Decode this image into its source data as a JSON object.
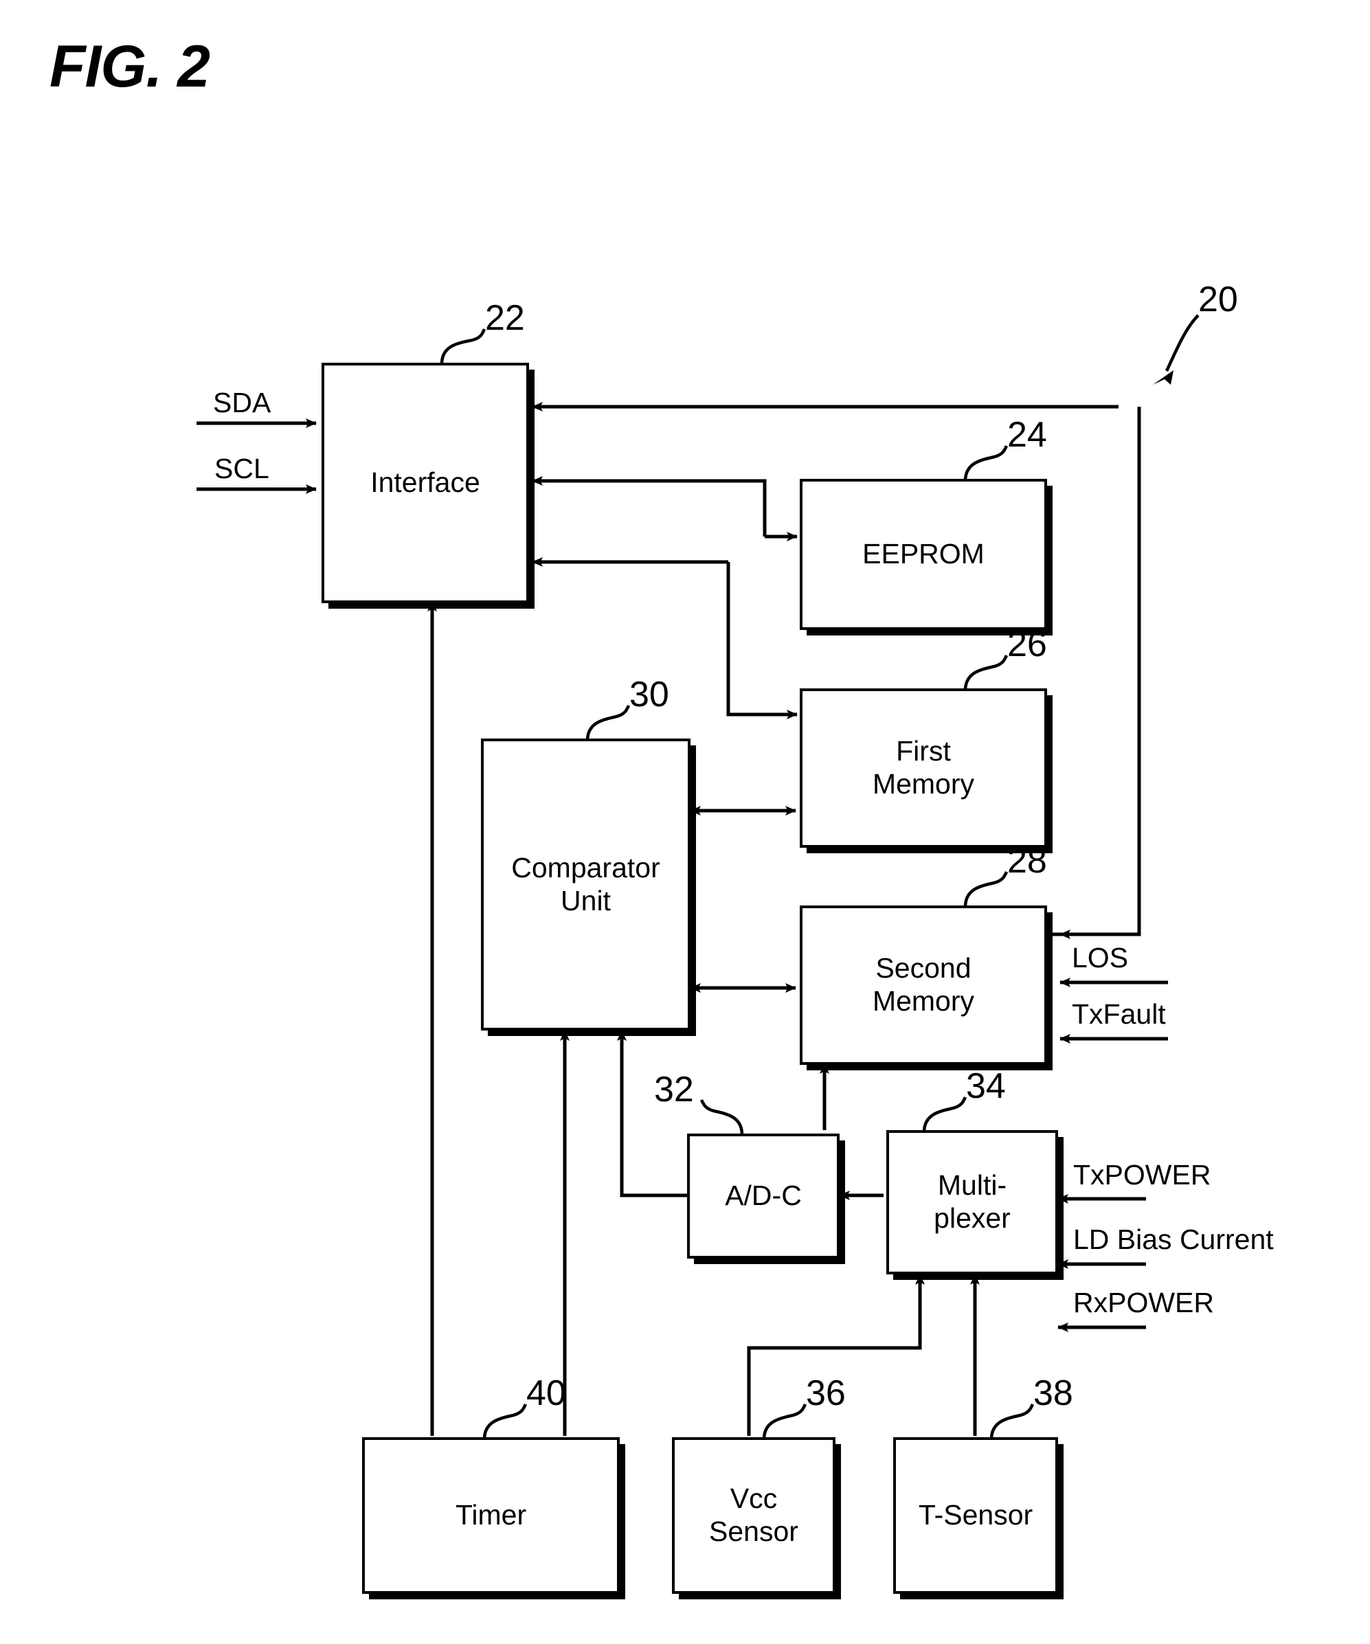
{
  "figure": {
    "title": "FIG. 2",
    "system_ref": "20"
  },
  "blocks": [
    {
      "id": "interface",
      "label": "Interface",
      "ref": "22"
    },
    {
      "id": "eeprom",
      "label": "EEPROM",
      "ref": "24"
    },
    {
      "id": "first_mem",
      "label": "First\nMemory",
      "ref": "26"
    },
    {
      "id": "second_mem",
      "label": "Second\nMemory",
      "ref": "28"
    },
    {
      "id": "comparator",
      "label": "Comparator\nUnit",
      "ref": "30"
    },
    {
      "id": "adc",
      "label": "A/D-C",
      "ref": "32"
    },
    {
      "id": "multiplexer",
      "label": "Multi-\nplexer",
      "ref": "34"
    },
    {
      "id": "vcc_sensor",
      "label": "Vcc\nSensor",
      "ref": "36"
    },
    {
      "id": "t_sensor",
      "label": "T-Sensor",
      "ref": "38"
    },
    {
      "id": "timer",
      "label": "Timer",
      "ref": "40"
    }
  ],
  "signals": {
    "interface_inputs": [
      "SDA",
      "SCL"
    ],
    "second_memory_inputs": [
      "LOS",
      "TxFault"
    ],
    "multiplexer_inputs": [
      "TxPOWER",
      "LD Bias Current",
      "RxPOWER"
    ]
  },
  "labels": {
    "sda": "SDA",
    "scl": "SCL",
    "los": "LOS",
    "txfault": "TxFault",
    "txpower": "TxPOWER",
    "ld_bias_current": "LD Bias Current",
    "rxpower": "RxPOWER",
    "interface": "Interface",
    "eeprom": "EEPROM",
    "first_memory_l1": "First",
    "first_memory_l2": "Memory",
    "second_memory_l1": "Second",
    "second_memory_l2": "Memory",
    "comparator_l1": "Comparator",
    "comparator_l2": "Unit",
    "adc": "A/D-C",
    "multiplexer_l1": "Multi-",
    "multiplexer_l2": "plexer",
    "vcc_sensor_l1": "Vcc",
    "vcc_sensor_l2": "Sensor",
    "t_sensor": "T-Sensor",
    "timer": "Timer"
  },
  "refs": {
    "system": "20",
    "interface": "22",
    "eeprom": "24",
    "first_memory": "26",
    "second_memory": "28",
    "comparator": "30",
    "adc": "32",
    "multiplexer": "34",
    "vcc_sensor": "36",
    "t_sensor": "38",
    "timer": "40"
  },
  "colors": {
    "ink": "#000000",
    "paper": "#ffffff"
  }
}
